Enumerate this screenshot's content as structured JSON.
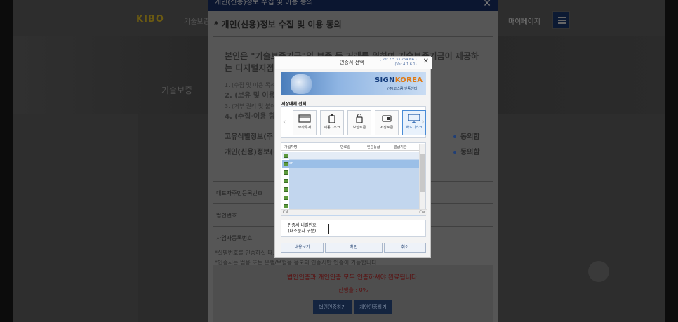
{
  "background": {
    "logo": "KIBO",
    "logo_sub": "기술보증",
    "mypage": "마이페이지",
    "hero_text": "기술보증",
    "colors": {
      "brand_gold": "#6b5a12",
      "nav_dark": "#0c1a33"
    }
  },
  "modal": {
    "title": "개인(신용)정보 수집 및 이용 동의",
    "section_title": "* 개인(신용)정보 수집 및 이용 동의",
    "main_statement": "본인은 \"기술보증기금\"의 보증 등 거래를 위하여 기술보증기금이 제공하는 디지털지점 서비스 ... 동의합니다.",
    "list_items": [
      "1. (수집 및 이용 목적) ... 유지·관리",
      "2. (보유 및 이용기간)",
      "3. (거부 권리 및 불이익) ... 동의하는 서비스 제공을 위한 필수적 사항",
      "4. (수집·이용 항목)"
    ],
    "agree_rows": [
      {
        "label": "고유식별정보(주)",
        "status": "동의함"
      },
      {
        "label": "개인(신용)정보(선)",
        "status": "동의함"
      }
    ],
    "form_rows": [
      "대표자주민등록번호",
      "법인번호",
      "사업자등록번호"
    ],
    "notes": [
      "*실명번호를 인증하실 때...",
      "*인증서는 범용 또는 은행/보험용 용도의 인증서만 인증이 가능합니다."
    ],
    "result_message": "법인인증과 개인인증 모두 인증하셔야 완료됩니다.",
    "progress_text": "진행율 : 0%",
    "buttons": {
      "corp_cert": "법인인증하기",
      "personal_cert": "개인인증하기"
    }
  },
  "cert_dialog": {
    "title": "인증서 선택",
    "version_line1": "( Ver 2.5.33.264 NA )",
    "version_line2": "(Ver 4.1.6.1)",
    "banner_brand_a": "SIGN",
    "banner_brand_b": "KOREA",
    "banner_sub": "(주)코스콤 인증센터",
    "storage_label": "저장매체 선택",
    "media": [
      {
        "label": "브라우저",
        "icon": "browser-icon"
      },
      {
        "label": "이동디스크",
        "icon": "usb-icon"
      },
      {
        "label": "보안토큰",
        "icon": "security-token-icon"
      },
      {
        "label": "저장토큰",
        "icon": "storage-token-icon"
      },
      {
        "label": "하드디스크",
        "icon": "hard-disk-icon",
        "selected": true
      }
    ],
    "list_headers": [
      "가입자명",
      "만료일",
      "인증등급",
      "발급기관"
    ],
    "list_row_first_cell": "cn",
    "scroll_left": "CN",
    "scroll_right": "Cor",
    "pw_label_line1": "인증서 비밀번호",
    "pw_label_line2": "(대소문자 구분)",
    "pw_value": "",
    "buttons": {
      "view": "내용보기",
      "ok": "확인",
      "cancel": "취소"
    },
    "colors": {
      "selected_row": "#9bbfe7",
      "brand_blue": "#143c7c",
      "brand_orange": "#e07a13"
    }
  }
}
